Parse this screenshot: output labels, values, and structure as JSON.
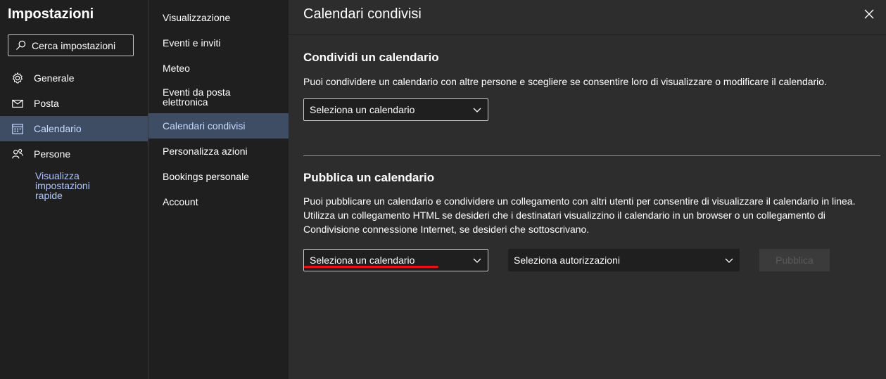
{
  "settings": {
    "title": "Impostazioni",
    "search_placeholder": "Cerca impostazioni"
  },
  "left_nav": {
    "items": [
      {
        "label": "Generale",
        "icon": "gear-icon"
      },
      {
        "label": "Posta",
        "icon": "mail-icon"
      },
      {
        "label": "Calendario",
        "icon": "calendar-icon",
        "selected": true
      },
      {
        "label": "Persone",
        "icon": "people-icon"
      }
    ],
    "quick_settings_link": "Visualizza impostazioni rapide"
  },
  "calendar_nav": {
    "items": [
      {
        "label": "Visualizzazione"
      },
      {
        "label": "Eventi e inviti"
      },
      {
        "label": "Meteo"
      },
      {
        "label": "Eventi da posta elettronica"
      },
      {
        "label": "Calendari condivisi",
        "selected": true
      },
      {
        "label": "Personalizza azioni"
      },
      {
        "label": "Bookings personale"
      },
      {
        "label": "Account"
      }
    ]
  },
  "panel": {
    "title": "Calendari condivisi",
    "share": {
      "title": "Condividi un calendario",
      "description": "Puoi condividere un calendario con altre persone e scegliere se consentire loro di visualizzare o modificare il calendario.",
      "select_value": "Seleziona un calendario"
    },
    "publish": {
      "title": "Pubblica un calendario",
      "description_1": "Puoi pubblicare un calendario e condividere un collegamento con altri utenti per consentire di visualizzare il calendario in linea.",
      "description_2": "Utilizza un collegamento HTML se desideri che i destinatari visualizzino il calendario in un browser o un collegamento di",
      "description_3": "Condivisione connessione Internet, se desideri che sottoscrivano.",
      "calendar_select_value": "Seleziona un calendario",
      "permissions_select_value": "Seleziona autorizzazioni",
      "publish_button": "Pubblica"
    }
  },
  "colors": {
    "selected_bg": "#3e4c64",
    "panel_bg": "#2d2d2d",
    "nav_bg": "#1f1f1f",
    "link": "#aec8ff",
    "annotation": "#e8101b"
  }
}
